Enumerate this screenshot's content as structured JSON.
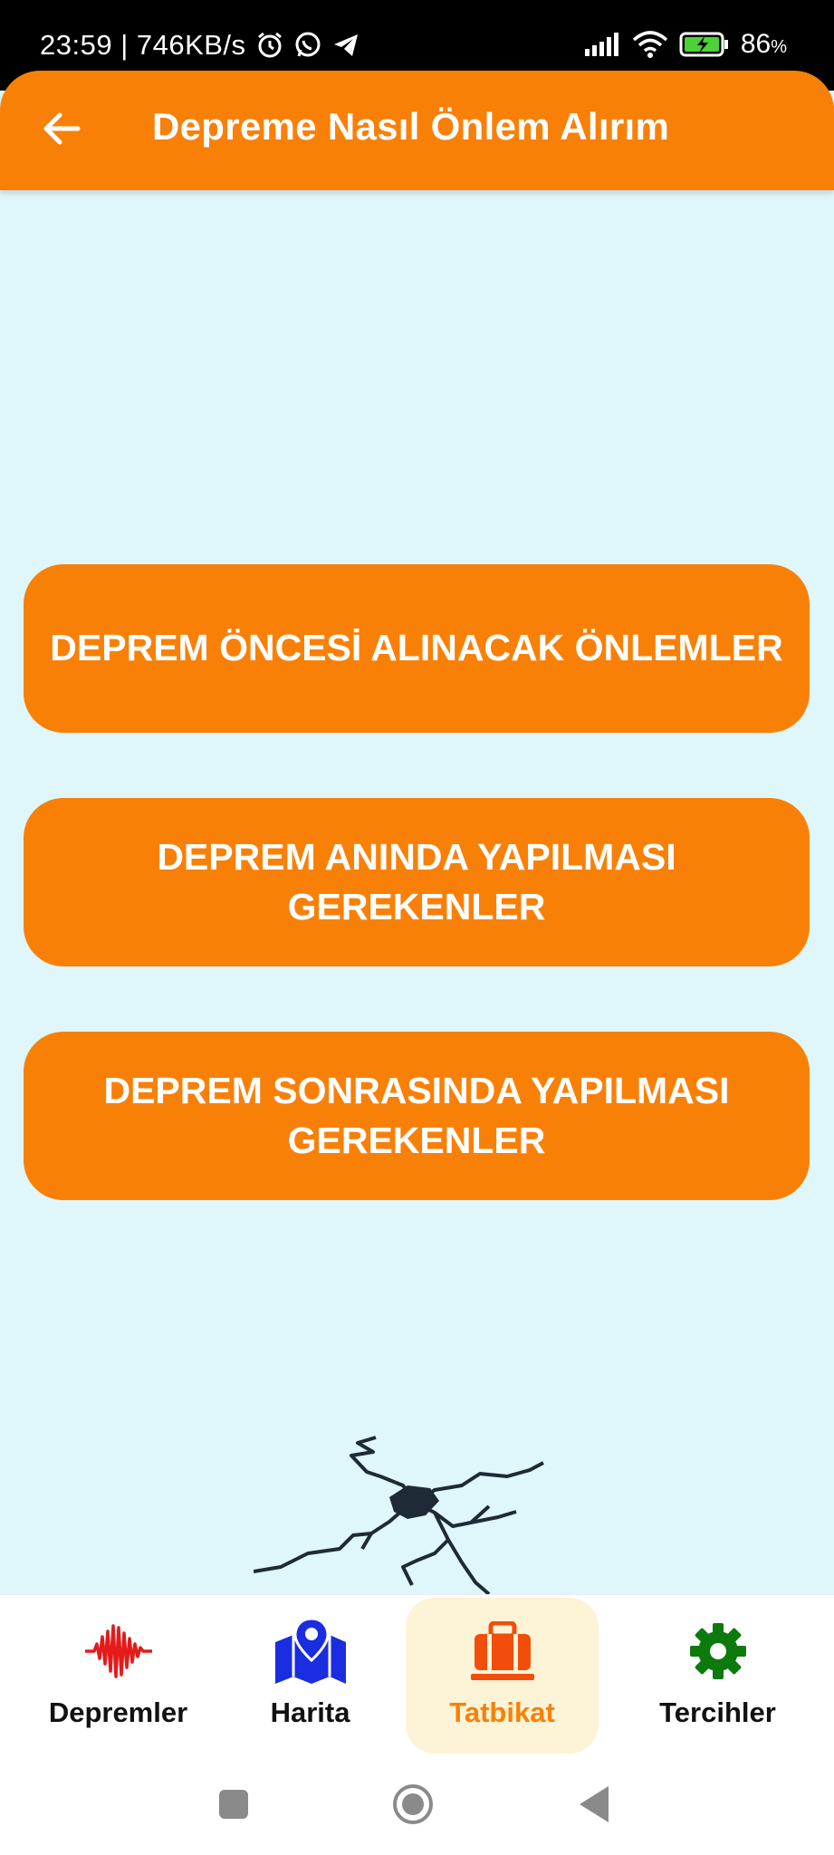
{
  "status_bar": {
    "time_speed": "23:59 | 746KB/s",
    "battery": "86",
    "battery_unit": "%",
    "icons": [
      "alarm-icon",
      "whatsapp-icon",
      "telegram-icon",
      "signal-icon",
      "wifi-icon",
      "battery-icon"
    ]
  },
  "appbar": {
    "title": "Depreme Nasıl Önlem Alırım",
    "back_icon": "arrow-left-icon"
  },
  "actions": [
    {
      "label": "DEPREM ÖNCESİ ALINACAK ÖNLEMLER"
    },
    {
      "label": "DEPREM ANINDA YAPILMASI GEREKENLER"
    },
    {
      "label": "DEPREM SONRASINDA YAPILMASI GEREKENLER"
    }
  ],
  "bottom_nav": {
    "items": [
      {
        "label": "Depremler",
        "icon": "seismic-wave-icon",
        "color": "#e31b1b"
      },
      {
        "label": "Harita",
        "icon": "map-pin-icon",
        "color": "#1a2de0"
      },
      {
        "label": "Tatbikat",
        "icon": "briefcase-icon",
        "color": "#f24d0a",
        "active": true
      },
      {
        "label": "Tercihler",
        "icon": "gear-icon",
        "color": "#0c7a0c"
      }
    ]
  },
  "colors": {
    "accent": "#f98007",
    "background": "#dff6fb",
    "active_nav_bg": "#fdf3d6"
  },
  "system_nav": [
    "recents-button",
    "home-button",
    "back-button"
  ]
}
